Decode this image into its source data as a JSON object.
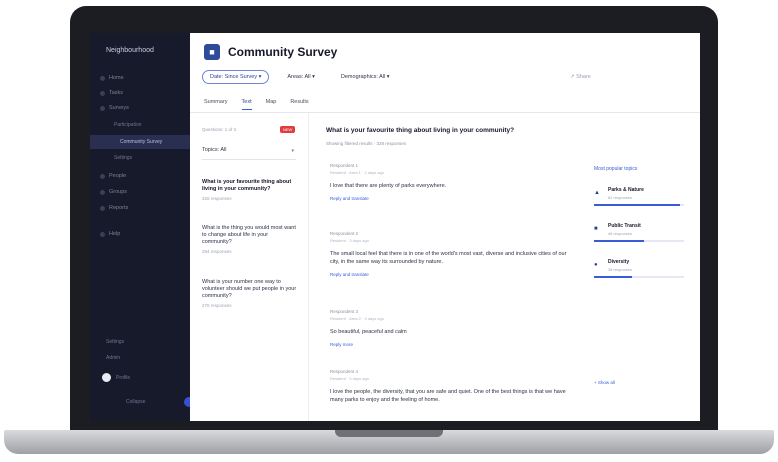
{
  "app": {
    "title": "Community Survey",
    "icon": "survey-icon",
    "accent": "#3b5bd6"
  },
  "sidebar": {
    "org": "Neighbourhood",
    "items": [
      {
        "label": "Home",
        "icon": "home-icon"
      },
      {
        "label": "Tasks",
        "icon": "task-icon"
      },
      {
        "label": "Surveys",
        "icon": "survey-icon"
      }
    ],
    "subitems": [
      "Participation",
      "Community Survey",
      "Settings"
    ],
    "active_sub": "Community Survey",
    "more_items": [
      {
        "label": "People",
        "icon": "people-icon"
      },
      {
        "label": "Groups",
        "icon": "group-icon"
      },
      {
        "label": "Reports",
        "icon": "report-icon"
      },
      {
        "label": "Help",
        "icon": "help-icon"
      }
    ],
    "footer": [
      "Settings",
      "Admin"
    ],
    "user": "Profile",
    "collapse": "Collapse"
  },
  "filters": [
    {
      "label": "Date: Since Survey",
      "pill": true
    },
    {
      "label": "Areas: All",
      "pill": false
    },
    {
      "label": "Demographics: All",
      "pill": false
    }
  ],
  "share_label": "Share",
  "tabs": [
    "Summary",
    "Text",
    "Map",
    "Results"
  ],
  "active_tab": "Text",
  "left_panel": {
    "count_label": "Questions: 1 of 3",
    "badge": "NEW",
    "select_value": "Topics: All",
    "questions": [
      {
        "title": "What is your favourite thing about living in your community?",
        "meta": "328 responses"
      },
      {
        "title": "What is the thing you would most want to change about life in your community?",
        "meta": "294 responses"
      },
      {
        "title": "What is your number one way to volunteer should we put people in your community?",
        "meta": "276 responses"
      }
    ]
  },
  "content": {
    "question": "What is your favourite thing about living in your community?",
    "showing": "Showing filtered results · 328 responses",
    "responses": [
      {
        "name": "Respondent 1",
        "meta": "Resident · Area 1 · 2 days ago",
        "text": "I love that there are plenty of parks everywhere.",
        "reply": "Reply and translate"
      },
      {
        "name": "Respondent 2",
        "meta": "Resident · 3 days ago",
        "text": "The small local feel that there is in one of the world's most vast, diverse and inclusive cities of our city, in the same way its surrounded by nature.",
        "reply": "Reply and translate"
      },
      {
        "name": "Respondent 3",
        "meta": "Resident · Area 2 · 4 days ago",
        "text": "So beautiful, peaceful and calm",
        "reply": "Reply more"
      },
      {
        "name": "Respondent 4",
        "meta": "Resident · 5 days ago",
        "text": "I love the people, the diversity, that you are safe and quiet. One of the best things is that we have many parks to enjoy and the feeling of home.",
        "reply": ""
      }
    ]
  },
  "right_panel": {
    "title": "Most popular topics",
    "topics": [
      {
        "name": "Parks & Nature",
        "count": "82 responses",
        "share": 0.95,
        "icon": "park-icon"
      },
      {
        "name": "Public Transit",
        "count": "46 responses",
        "share": 0.55,
        "icon": "transit-icon"
      },
      {
        "name": "Diversity",
        "count": "38 responses",
        "share": 0.42,
        "icon": "diversity-icon"
      }
    ],
    "show_all": "+ Show all"
  }
}
